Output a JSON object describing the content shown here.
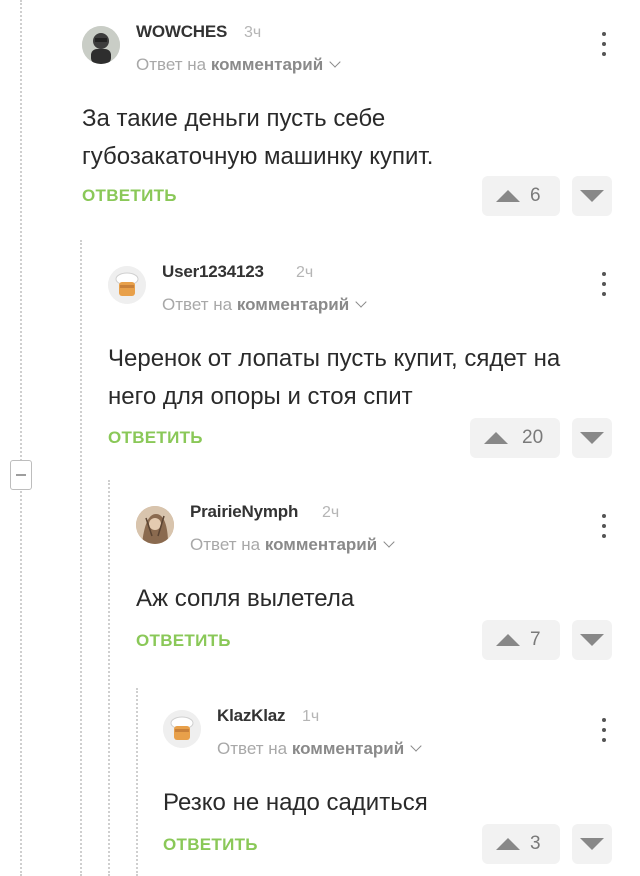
{
  "reply_to_prefix": "Ответ на",
  "reply_to_target": "комментарий",
  "reply_label": "ОТВЕТИТЬ",
  "comments": [
    {
      "username": "WOWCHES",
      "time": "3ч",
      "text": "За такие деньги пусть себе губозакаточную машинку купит.",
      "votes": "6",
      "avatar": "photo-avatar"
    },
    {
      "username": "User1234123",
      "time": "2ч",
      "text": "Черенок от лопаты пусть купит, сядет на него для опоры и стоя спит",
      "votes": "20",
      "avatar": "default-chef-avatar"
    },
    {
      "username": "PrairieNymph",
      "time": "2ч",
      "text": "Аж сопля вылетела",
      "votes": "7",
      "avatar": "photo-avatar"
    },
    {
      "username": "KlazKlaz",
      "time": "1ч",
      "text": "Резко не надо садиться",
      "votes": "3",
      "avatar": "default-chef-avatar"
    }
  ],
  "colors": {
    "accent": "#8ac858",
    "vote_bg": "#f2f2f2",
    "thread_line": "#cfcfcf"
  }
}
